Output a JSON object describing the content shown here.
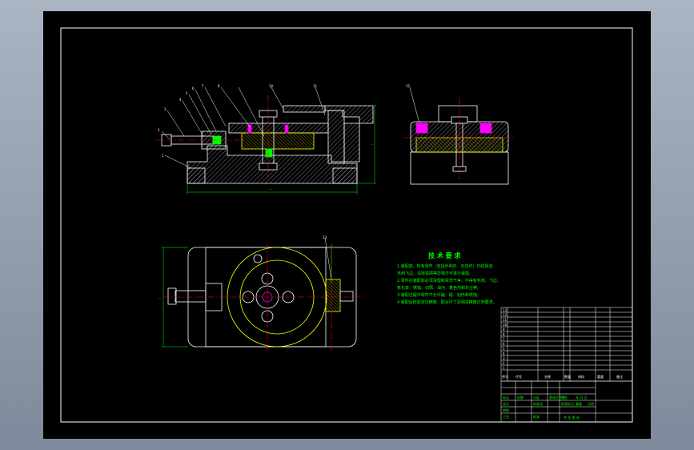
{
  "drawing": {
    "colors": {
      "background": "#000000",
      "outline": "#ffffff",
      "hatch": "#c8c8c8",
      "dimension": "#00ff00",
      "centerline": "#ff0000",
      "highlight": "#ffff00",
      "accent": "#ff00ff",
      "leader": "#00ffff"
    },
    "front_view": {
      "balloons": [
        "1",
        "2",
        "3",
        "4",
        "5",
        "6",
        "7",
        "8",
        "10",
        "11"
      ],
      "overall_width": "---",
      "overall_height": "--"
    },
    "side_view": {
      "balloons": [
        "12"
      ]
    },
    "top_view": {
      "balloons": [
        "13"
      ],
      "side_dim": "--"
    },
    "technical_requirements": {
      "title": "技 术 要 求",
      "lines": [
        "1.装配前，所有零件（包括外购件、外协件）均应除去",
        "  毛刺飞边，清除铁屑等异物方可进行装配。",
        "2.零件在装配前必须清理和清洗干净，不得有毛刺、飞边、",
        "  氧化皮、锈蚀、切屑、油污、着色剂和灰尘等。",
        "3.装配过程中零件不允许磕、碰、划伤和锈蚀。",
        "4.装配后检验定位精度，配合尺寸及相关精度达到要求。"
      ]
    },
    "parts_list": {
      "rows": [
        "13",
        "12",
        "11",
        "10",
        "9",
        "8",
        "7",
        "6",
        "5",
        "4",
        "3",
        "2",
        "1"
      ],
      "header": {
        "no": "序号",
        "code": "代号",
        "name": "名称",
        "qty": "数量",
        "material": "材料",
        "weight": "重量",
        "note": "备注"
      }
    },
    "title_block": {
      "labels": [
        "标记",
        "处数",
        "分区",
        "更改文件号",
        "签名",
        "年.月.日",
        "设计",
        "标准化",
        "审核",
        "工艺",
        "批准",
        "阶段标记",
        "重量",
        "比例"
      ],
      "sheet": "共 张  第 张"
    }
  }
}
